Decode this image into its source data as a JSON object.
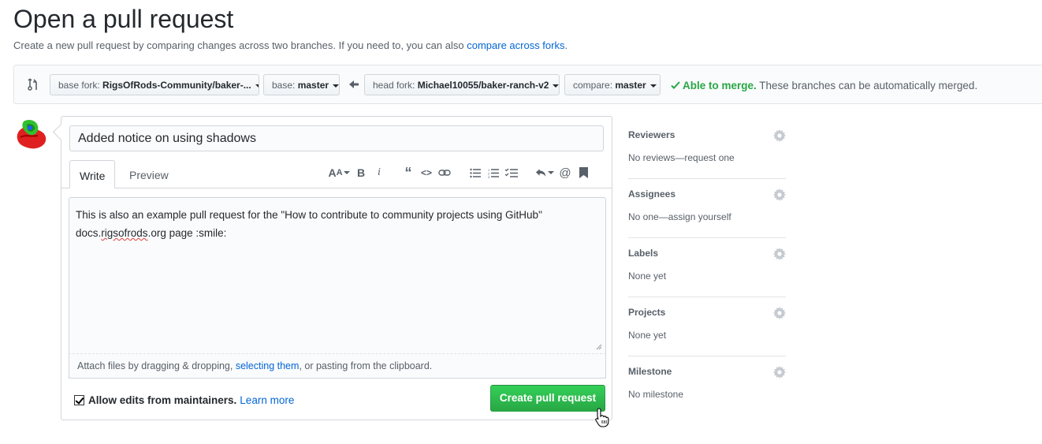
{
  "page": {
    "title": "Open a pull request",
    "subtitle_prefix": "Create a new pull request by comparing changes across two branches. If you need to, you can also ",
    "subtitle_link": "compare across forks",
    "subtitle_suffix": "."
  },
  "compare": {
    "base_fork_label": "base fork: ",
    "base_fork_value": "RigsOfRods-Community/baker-...",
    "base_label": "base: ",
    "base_value": "master",
    "head_fork_label": "head fork: ",
    "head_fork_value": "Michael10055/baker-ranch-v2",
    "compare_label": "compare: ",
    "compare_value": "master",
    "merge_ok": "Able to merge.",
    "merge_note": " These branches can be automatically merged."
  },
  "editor": {
    "title_value": "Added notice on using shadows",
    "tabs": [
      "Write",
      "Preview"
    ],
    "body_line1": "This is also an example pull request for the \"How to contribute to community projects using GitHub\"",
    "body_line2_prefix": "docs.",
    "body_line2_misspelled": "rigsofrods",
    "body_line2_suffix": ".org page :smile:",
    "attach_prefix": "Attach files by dragging & dropping, ",
    "attach_link": "selecting them",
    "attach_suffix": ", or pasting from the clipboard.",
    "allow_edits_label": "Allow edits from maintainers.",
    "allow_edits_checked": true,
    "learn_more": "Learn more",
    "create_button": "Create pull request",
    "toolbar_icons": [
      "text-size-icon",
      "bold-icon",
      "italic-icon",
      "quote-icon",
      "code-icon",
      "link-icon",
      "unordered-list-icon",
      "ordered-list-icon",
      "task-list-icon",
      "reply-icon",
      "mention-icon",
      "bookmark-icon"
    ]
  },
  "sidebar": [
    {
      "title": "Reviewers",
      "value": "No reviews—request one"
    },
    {
      "title": "Assignees",
      "value": "No one—assign yourself"
    },
    {
      "title": "Labels",
      "value": "None yet"
    },
    {
      "title": "Projects",
      "value": "None yet"
    },
    {
      "title": "Milestone",
      "value": "No milestone"
    }
  ],
  "colors": {
    "link": "#0366d6",
    "success": "#28a745",
    "button_green": "#2ea44f"
  }
}
